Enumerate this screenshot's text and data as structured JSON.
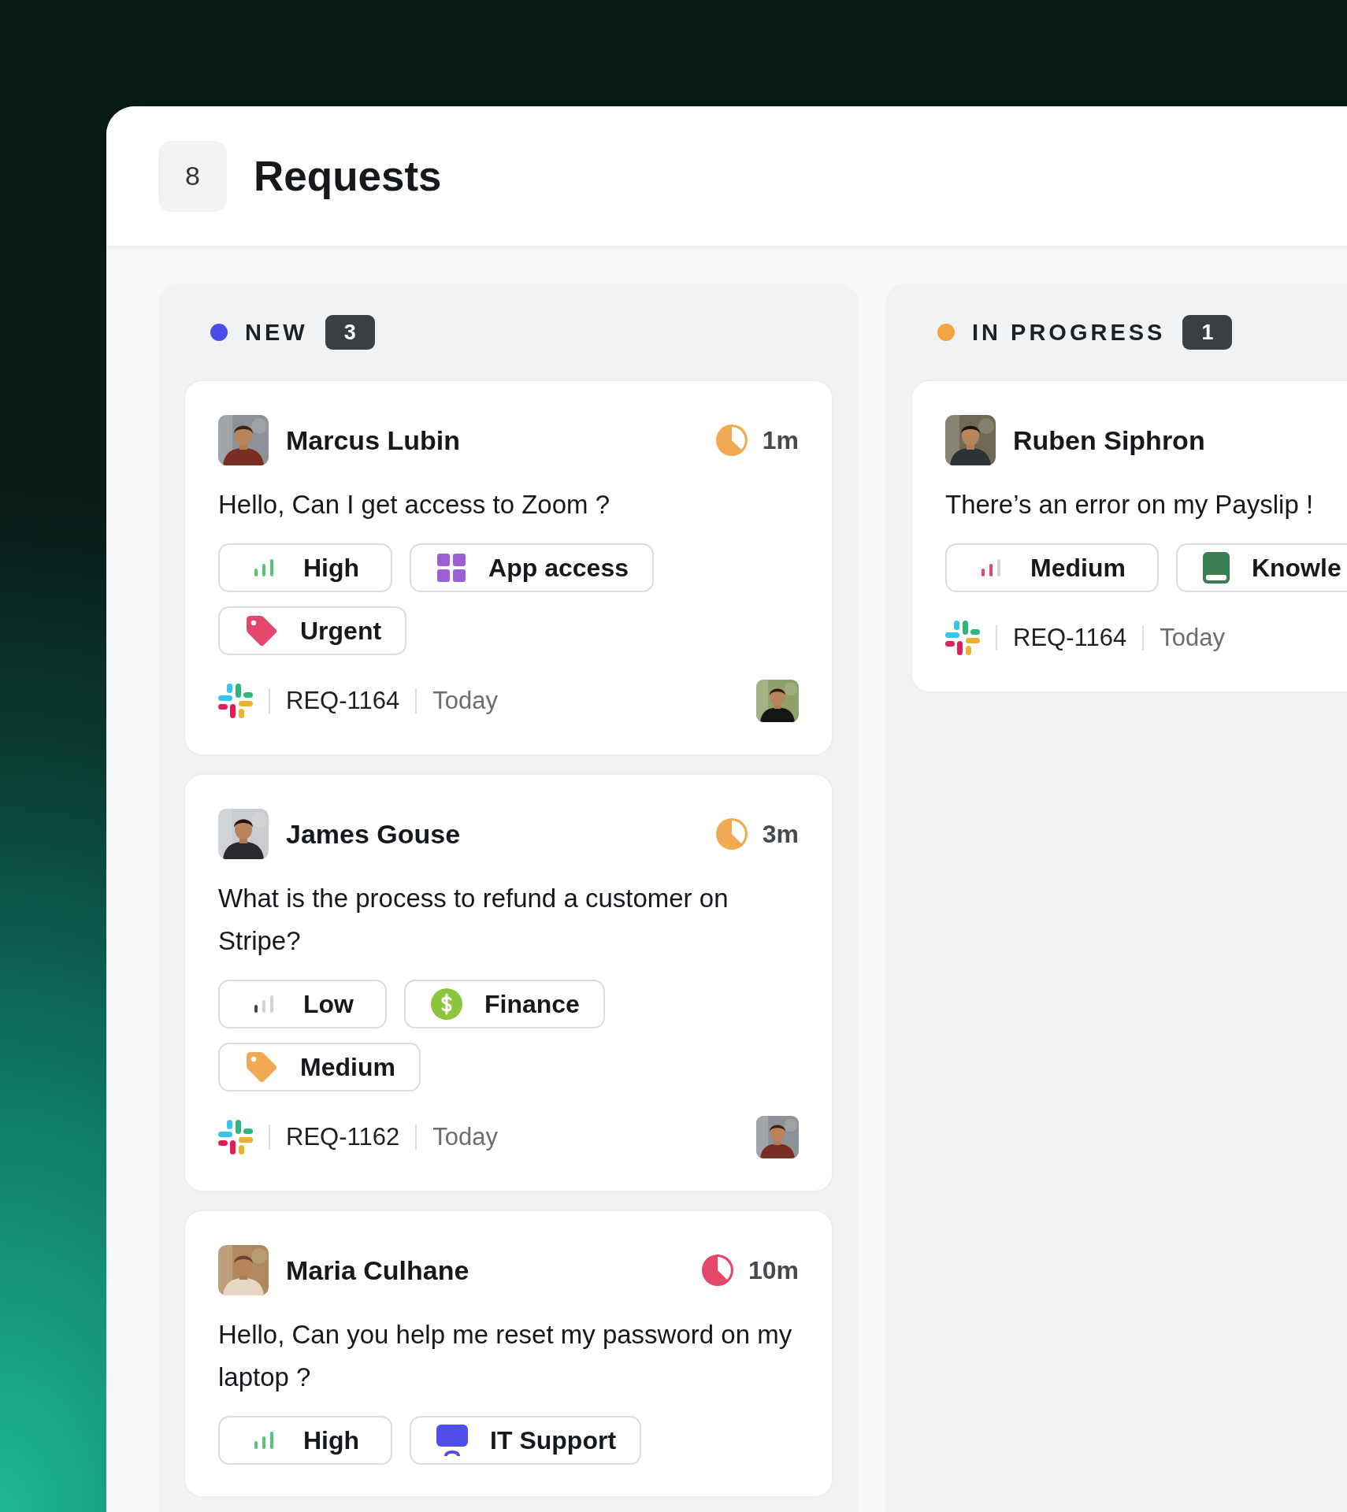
{
  "header": {
    "count": "8",
    "title": "Requests"
  },
  "columns": [
    {
      "title": "NEW",
      "count": "3",
      "color": "#4a4de8",
      "cards": [
        {
          "name": "Marcus Lubin",
          "avatar": {
            "kind": "picture"
          },
          "time": "1m",
          "color": "#f2a953",
          "message": "Hello, Can I get access to Zoom ?",
          "tags": [
            {
              "kind": "high",
              "label": "High"
            },
            {
              "kind": "apps",
              "label": "App access"
            },
            {
              "kind": "label",
              "label": "Urgent",
              "color": "#e5466b"
            }
          ],
          "ref": "REQ-1164",
          "date": "Today",
          "assignee": {
            "kind": "picture"
          }
        },
        {
          "name": "James Gouse",
          "avatar": {
            "kind": "picture"
          },
          "time": "3m",
          "color": "#f2a953",
          "message": "What is the process to refund a customer on Stripe?",
          "tags": [
            {
              "kind": "low",
              "label": "Low"
            },
            {
              "kind": "finance",
              "label": "Finance"
            },
            {
              "kind": "label",
              "label": "Medium",
              "color": "#f2a953"
            }
          ],
          "ref": "REQ-1162",
          "date": "Today",
          "assignee": {
            "kind": "picture"
          }
        },
        {
          "name": "Maria Culhane",
          "avatar": {
            "kind": "picture"
          },
          "time": "10m",
          "color": "#e5466b",
          "message": "Hello, Can you help me reset my password on my laptop ?",
          "tags": [
            {
              "kind": "high",
              "label": "High"
            },
            {
              "kind": "monitor",
              "label": "IT Support"
            }
          ]
        }
      ]
    },
    {
      "title": "IN PROGRESS",
      "count": "1",
      "color": "#f2a642",
      "cards": [
        {
          "name": "Ruben Siphron",
          "avatar": {
            "kind": "picture"
          },
          "message": "There’s an error on my Payslip !",
          "tags": [
            {
              "kind": "medium",
              "label": "Medium"
            },
            {
              "kind": "book",
              "label": "Knowle"
            }
          ],
          "ref": "REQ-1164",
          "date": "Today"
        }
      ]
    }
  ]
}
